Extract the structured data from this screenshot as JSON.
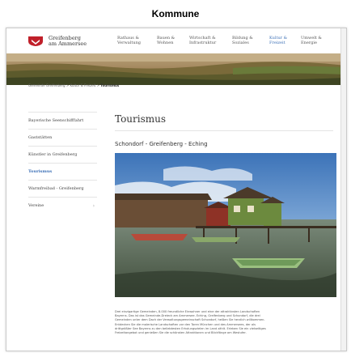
{
  "caption": "Kommune",
  "logo": {
    "line1": "Greifenberg",
    "line2": "am Ammersee"
  },
  "nav": [
    {
      "line1": "Rathaus &",
      "line2": "Verwaltung"
    },
    {
      "line1": "Bauen &",
      "line2": "Wohnen"
    },
    {
      "line1": "Wirtschaft &",
      "line2": "Infrastruktur"
    },
    {
      "line1": "Bildung &",
      "line2": "Soziales"
    },
    {
      "line1": "Kultur &",
      "line2": "Freizeit"
    },
    {
      "line1": "Umwelt &",
      "line2": "Energie"
    }
  ],
  "colors": {
    "accent": "#3b6fb6",
    "text": "#333333"
  },
  "breadcrumb": {
    "home": "Gemeinde Greifenberg",
    "section": "Kultur & Freizeit",
    "current": "Tourismus",
    "separator": ">"
  },
  "sidebar": [
    {
      "label": "Bayerische Seenschifffahrt"
    },
    {
      "label": "Gaststätten"
    },
    {
      "label": "Künstler in Greifenberg"
    },
    {
      "label": "Tourismus"
    },
    {
      "label": "Warmfreibad - Greifenberg"
    },
    {
      "label": "Vereine"
    }
  ],
  "main": {
    "title": "Tourismus",
    "subtitle": "Schondorf - Greifenberg - Eching",
    "body": [
      "Drei einzigartige Gemeinden, 8.000 freundliche Einwohner und eine der attraktivsten Landschaften",
      "Bayerns. Das ist das Gemeinde-Dreieck am Ammersee. Eching, Greifenberg und Schondorf, die drei",
      "Gemeinden unter dem Dach der Verwaltungsgemeinschaft Schondorf, heißen Sie herzlich willkommen.",
      "Entdecken Sie die malerische Landschaften vor den Toren München und des Ammersees, der als",
      "drittgrößter See Bayerns zu den beliebtesten Erholungszielen im Land zählt. Erleben Sie ein vielseitiges",
      "Freizeitangebot und genießen Sie die schönsten Attraktionen und Blickfänge am Westufer."
    ]
  }
}
